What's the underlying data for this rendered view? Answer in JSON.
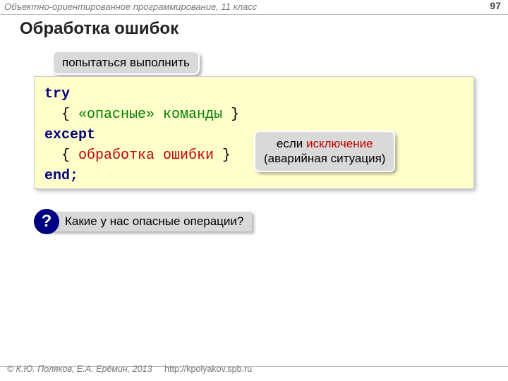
{
  "header": {
    "course": "Объектно-ориентированное программирование, 11 класс",
    "page_number": "97"
  },
  "title": "Обработка ошибок",
  "callout_top": "попытаться выполнить",
  "code": {
    "kw_try": "try",
    "line2_indent": "  { ",
    "line2_text": "«опасные» команды",
    "line2_close": " }",
    "kw_except": "except",
    "line4_indent": "  { ",
    "line4_text": "обработка ошибки",
    "line4_close": " }",
    "kw_end": "end;"
  },
  "callout_exc": {
    "line1_pre": "если ",
    "line1_word": "исключение",
    "line2": "(аварийная ситуация)"
  },
  "question": {
    "mark": "?",
    "text": "Какие у нас опасные операции?"
  },
  "footer": {
    "copyright": "© К.Ю. Поляков, Е.А. Ерёмин, 2013",
    "link": "http://kpolyakov.spb.ru"
  }
}
